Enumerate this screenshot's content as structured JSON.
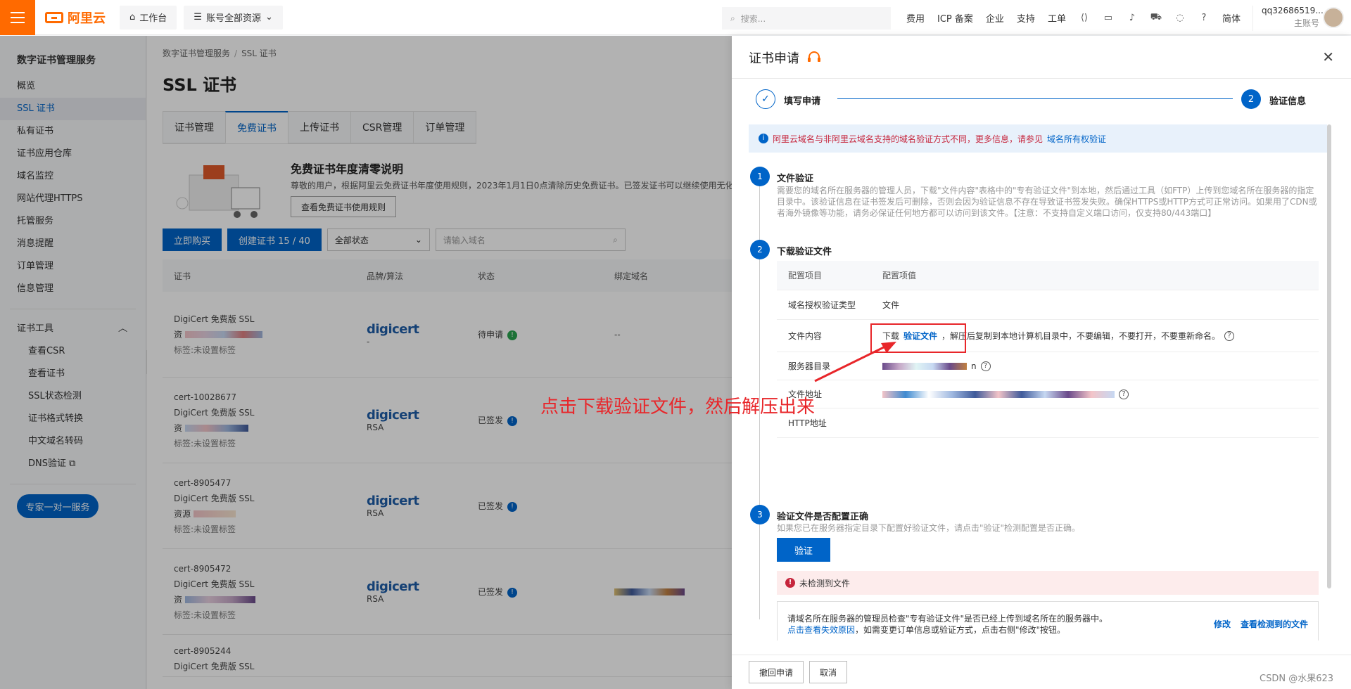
{
  "topbar": {
    "logo": "阿里云",
    "workbench": "工作台",
    "resources": "账号全部资源",
    "search_placeholder": "搜索...",
    "links": [
      "费用",
      "ICP 备案",
      "企业",
      "支持",
      "工单"
    ],
    "lang": "简体",
    "account_name": "qq32686519...",
    "account_role": "主账号",
    "icons": [
      "code-icon",
      "terminal-icon",
      "bell-icon",
      "cart-icon",
      "bulb-icon",
      "help-icon"
    ]
  },
  "sidebar": {
    "title": "数字证书管理服务",
    "items": [
      "概览",
      "SSL 证书",
      "私有证书",
      "证书应用仓库",
      "域名监控",
      "网站代理HTTPS",
      "托管服务",
      "消息提醒",
      "订单管理",
      "信息管理"
    ],
    "tools_title": "证书工具",
    "tools": [
      "查看CSR",
      "查看证书",
      "SSL状态检测",
      "证书格式转换",
      "中文域名转码",
      "DNS验证"
    ],
    "expert_button": "专家一对一服务"
  },
  "main": {
    "breadcrumb": [
      "数字证书管理服务",
      "SSL 证书"
    ],
    "title": "SSL 证书",
    "tabs": [
      "证书管理",
      "免费证书",
      "上传证书",
      "CSR管理",
      "订单管理"
    ],
    "notice_title": "免费证书年度清零说明",
    "notice_text": "尊敬的用户，根据阿里云免费证书年度使用规则，2023年1月1日0点清除历史免费证书。已签发证书可以继续使用无化",
    "notice_button": "查看免费证书使用规则",
    "buy_button": "立即购买",
    "create_button": "创建证书 15 / 40",
    "status_select": "全部状态",
    "domain_placeholder": "请输入域名",
    "columns": [
      "证书",
      "品牌/算法",
      "状态",
      "绑定域名"
    ],
    "rows": [
      {
        "id": "",
        "type": "DigiCert 免费版 SSL",
        "res": "资",
        "tag": "标签:未设置标签",
        "algo": "-",
        "status": "待申请",
        "domain": "--"
      },
      {
        "id": "cert-10028677",
        "type": "DigiCert 免费版 SSL",
        "res": "资",
        "tag": "标签:未设置标签",
        "algo": "RSA",
        "status": "已签发",
        "domain": ""
      },
      {
        "id": "cert-8905477",
        "type": "DigiCert 免费版 SSL",
        "res": "资源",
        "tag": "标签:未设置标签",
        "algo": "RSA",
        "status": "已签发",
        "domain": ""
      },
      {
        "id": "cert-8905472",
        "type": "DigiCert 免费版 SSL",
        "res": "资",
        "tag": "标签:未设置标签",
        "algo": "RSA",
        "status": "已签发",
        "domain": ""
      },
      {
        "id": "cert-8905244",
        "type": "DigiCert 免费版 SSL",
        "res": "",
        "tag": "",
        "algo": "",
        "status": "",
        "domain": ""
      }
    ],
    "brand": "digicert"
  },
  "drawer": {
    "title": "证书申请",
    "step1": "填写申请",
    "step2_num": "2",
    "step2": "验证信息",
    "alert_text": "阿里云域名与非阿里云域名支持的域名验证方式不同，更多信息，请参见",
    "alert_link": "域名所有权验证",
    "sec1_num": "1",
    "sec1_title": "文件验证",
    "sec1_desc": "需要您的域名所在服务器的管理人员，下载\"文件内容\"表格中的\"专有验证文件\"到本地，然后通过工具（如FTP）上传到您域名所在服务器的指定目录中。该验证信息在证书签发后可删除，否则会因为验证信息不存在导致证书签发失败。确保HTTPS或HTTP方式可正常访问。如果用了CDN或者海外镜像等功能，请务必保证任何地方都可以访问到该文件。【注意：不支持自定义端口访问，仅支持80/443端口】",
    "sec2_num": "2",
    "sec2_title": "下载验证文件",
    "kv_head": [
      "配置项目",
      "配置项值"
    ],
    "kv": {
      "type_key": "域名授权验证类型",
      "type_val": "文件",
      "content_key": "文件内容",
      "content_prefix": "下载",
      "content_link": "验证文件",
      "content_suffix": "，解压后复制到本地计算机目录中，不要编辑，不要打开，不要重新命名。",
      "dir_key": "服务器目录",
      "dir_val": "n",
      "url_key": "文件地址",
      "http_key": "HTTP地址"
    },
    "sec3_num": "3",
    "sec3_title": "验证文件是否配置正确",
    "sec3_desc": "如果您已在服务器指定目录下配置好验证文件，请点击\"验证\"检测配置是否正确。",
    "verify_button": "验证",
    "err_text": "未检测到文件",
    "errbox_line1": "请域名所在服务器的管理员检查\"专有验证文件\"是否已经上传到域名所在的服务器中。",
    "errbox_link": "点击查看失效原因",
    "errbox_line2": "，如需变更订单信息或验证方式，点击右侧\"修改\"按钮。",
    "modify": "修改",
    "view_detected": "查看检测到的文件",
    "withdraw_button": "撤回申请",
    "cancel_button": "取消"
  },
  "annotation": "点击下载验证文件，然后解压出来",
  "watermark": "CSDN @水果623",
  "colors": {
    "brand": "#ff6a00",
    "primary": "#0064c8",
    "annotation": "#e8262a"
  }
}
